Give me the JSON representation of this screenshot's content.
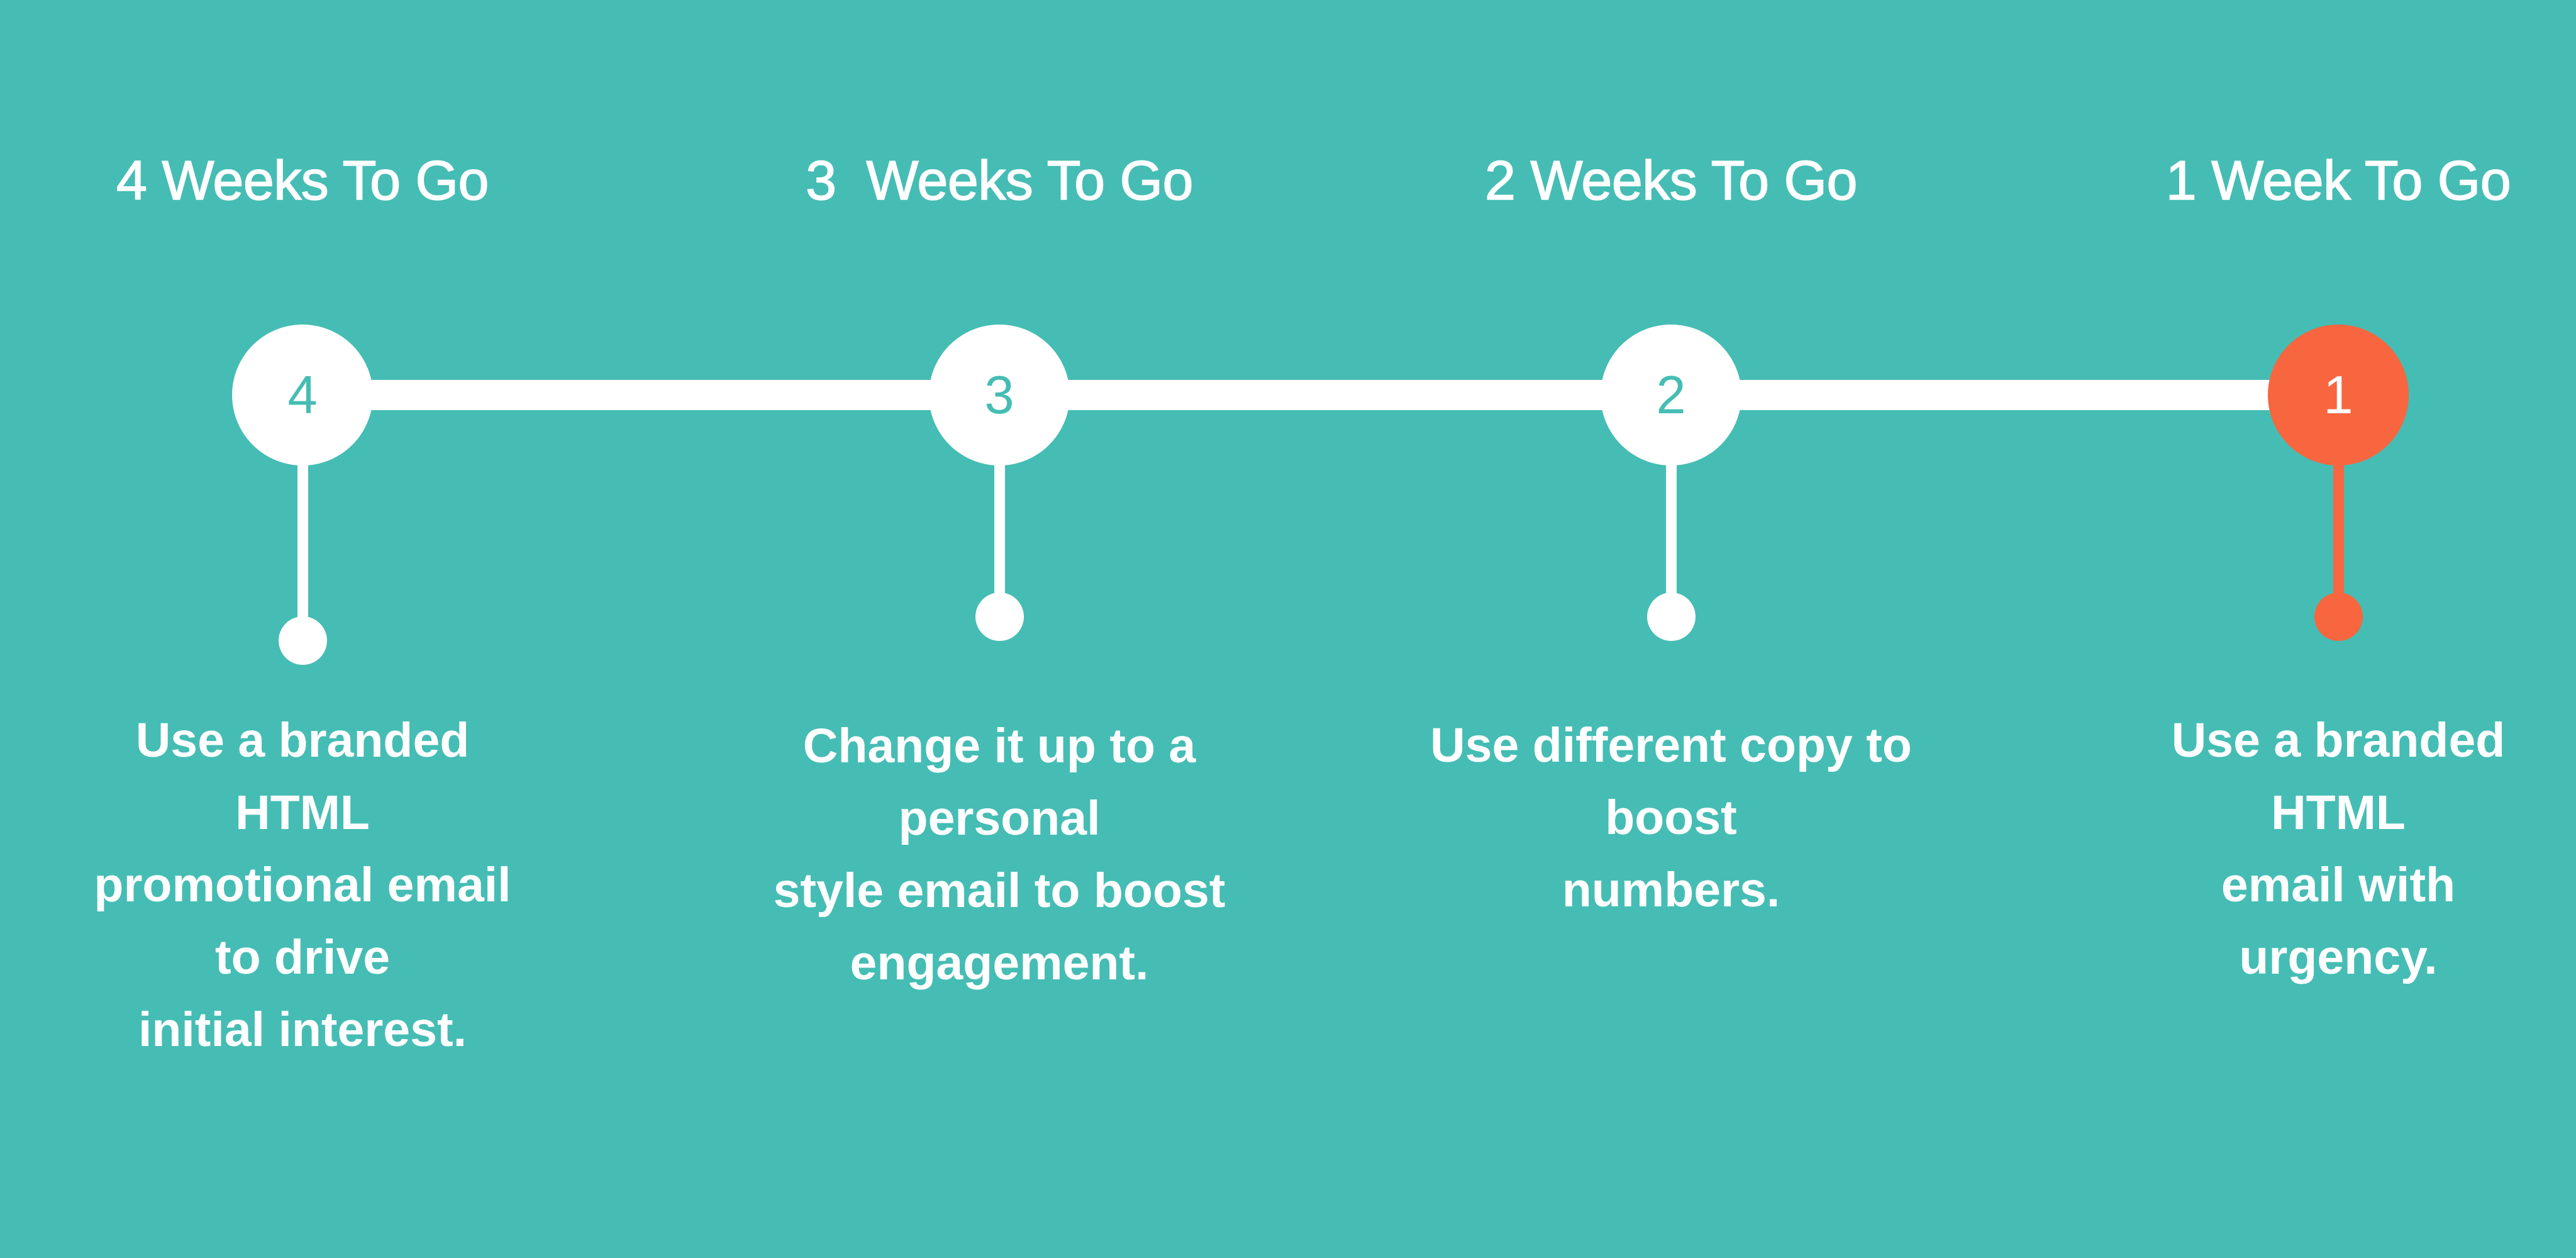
{
  "colors": {
    "background": "#45BDB4",
    "track": "#FFFFFF",
    "node_default": "#FFFFFF",
    "node_active": "#F7663F",
    "text": "#FFFFFF"
  },
  "timeline": {
    "steps": [
      {
        "title": "4 Weeks To Go",
        "number": "4",
        "active": false,
        "description_lines": [
          "Use a branded",
          "HTML",
          "promotional email",
          "to drive",
          "initial interest."
        ]
      },
      {
        "title": "3  Weeks To Go",
        "number": "3",
        "active": false,
        "description_lines": [
          "Change it up to a",
          "personal",
          "style email to boost",
          "engagement."
        ]
      },
      {
        "title": "2 Weeks To Go",
        "number": "2",
        "active": false,
        "description_lines": [
          "Use different copy to",
          "boost",
          "numbers."
        ]
      },
      {
        "title": "1 Week To Go",
        "number": "1",
        "active": true,
        "description_lines": [
          "Use a branded",
          "HTML",
          "email with",
          "urgency."
        ]
      }
    ]
  }
}
